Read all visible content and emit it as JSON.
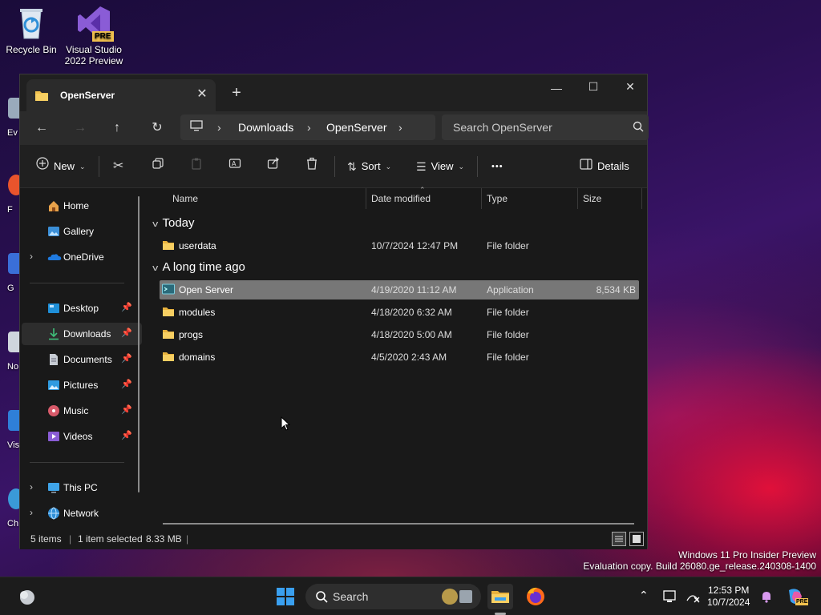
{
  "desktop": {
    "icons": [
      {
        "label": "Recycle Bin"
      },
      {
        "label": "Visual Studio 2022 Preview"
      }
    ],
    "edge_labels": [
      "Ev",
      "F",
      "G",
      "No",
      "Visu",
      "Ch"
    ],
    "pre_badge": "PRE"
  },
  "window": {
    "tab_title": "OpenServer",
    "new_tab": "+",
    "controls": {
      "minimize": "—",
      "maximize": "☐",
      "close": "✕"
    },
    "breadcrumb": [
      "Downloads",
      "OpenServer"
    ],
    "search_placeholder": "Search OpenServer",
    "commands": {
      "new": "New",
      "sort": "Sort",
      "view": "View",
      "details": "Details",
      "more": "•••"
    }
  },
  "sidebar": {
    "top": [
      {
        "label": "Home"
      },
      {
        "label": "Gallery"
      },
      {
        "label": "OneDrive"
      }
    ],
    "quick": [
      {
        "label": "Desktop",
        "pinned": true
      },
      {
        "label": "Downloads",
        "pinned": true,
        "active": true
      },
      {
        "label": "Documents",
        "pinned": true
      },
      {
        "label": "Pictures",
        "pinned": true
      },
      {
        "label": "Music",
        "pinned": true
      },
      {
        "label": "Videos",
        "pinned": true
      }
    ],
    "bottom": [
      {
        "label": "This PC"
      },
      {
        "label": "Network"
      }
    ]
  },
  "columns": {
    "name": "Name",
    "date": "Date modified",
    "type": "Type",
    "size": "Size"
  },
  "groups": [
    {
      "label": "Today",
      "rows": [
        {
          "name": "userdata",
          "date": "10/7/2024 12:47 PM",
          "type": "File folder",
          "size": ""
        }
      ]
    },
    {
      "label": "A long time ago",
      "rows": [
        {
          "name": "Open Server",
          "date": "4/19/2020 11:12 AM",
          "type": "Application",
          "size": "8,534 KB",
          "selected": true
        },
        {
          "name": "modules",
          "date": "4/18/2020 6:32 AM",
          "type": "File folder",
          "size": ""
        },
        {
          "name": "progs",
          "date": "4/18/2020 5:00 AM",
          "type": "File folder",
          "size": ""
        },
        {
          "name": "domains",
          "date": "4/5/2020 2:43 AM",
          "type": "File folder",
          "size": ""
        }
      ]
    }
  ],
  "status": {
    "items": "5 items",
    "selected": "1 item selected",
    "size": "8.33 MB"
  },
  "watermark": {
    "line1": "Windows 11 Pro Insider Preview",
    "line2": "Evaluation copy. Build 26080.ge_release.240308-1400"
  },
  "taskbar": {
    "search_placeholder": "Search",
    "time": "12:53 PM",
    "date": "10/7/2024",
    "copilot_badge": "PRE"
  },
  "colors": {
    "folder": "#f2c14e",
    "selected_row": "#777777",
    "accent": "#4cc2ff"
  }
}
